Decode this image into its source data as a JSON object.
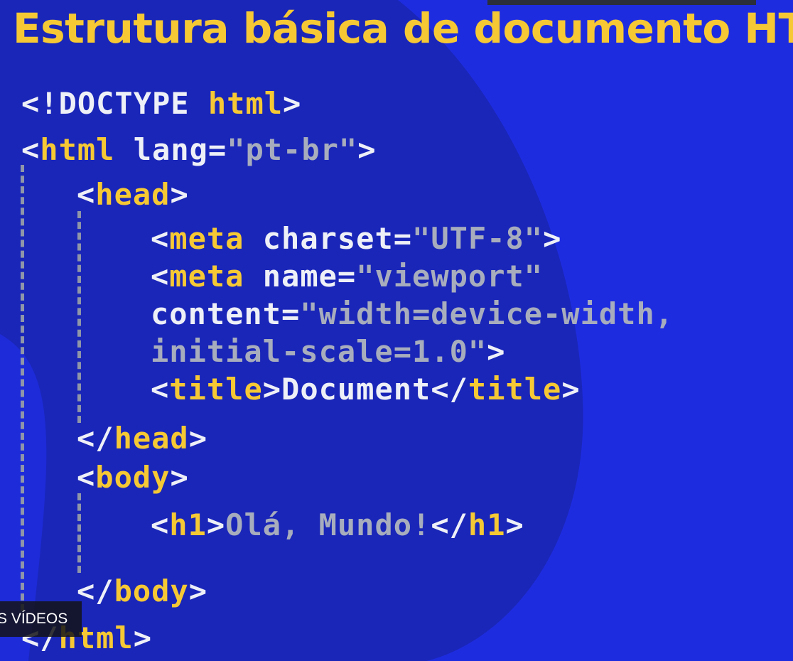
{
  "slide": {
    "title": "Estrutura básica de documento HT",
    "caption": "S VÍDEOS"
  },
  "colors": {
    "background": "#1e2ce0",
    "background_blob": "#1a26b8",
    "title": "#f6c934",
    "punctuation": "#eef0f7",
    "tag": "#f6c934",
    "attribute": "#eef0f7",
    "value": "#a8adbd",
    "text": "#eef0f7",
    "guide": "#8f96a8"
  },
  "code": {
    "lines": [
      [
        [
          "punct",
          "<!DOCTYPE "
        ],
        [
          "tag",
          "html"
        ],
        [
          "punct",
          ">"
        ]
      ],
      [
        [
          "punct",
          "<"
        ],
        [
          "tag",
          "html"
        ],
        [
          "punct",
          " "
        ],
        [
          "attr",
          "lang="
        ],
        [
          "value",
          "\"pt-br\""
        ],
        [
          "punct",
          ">"
        ]
      ],
      [
        [
          "punct",
          "<"
        ],
        [
          "tag",
          "head"
        ],
        [
          "punct",
          ">"
        ]
      ],
      [
        [
          "punct",
          "<"
        ],
        [
          "tag",
          "meta"
        ],
        [
          "punct",
          " "
        ],
        [
          "attr",
          "charset="
        ],
        [
          "value",
          "\"UTF-8\""
        ],
        [
          "punct",
          ">"
        ]
      ],
      [
        [
          "punct",
          "<"
        ],
        [
          "tag",
          "meta"
        ],
        [
          "punct",
          " "
        ],
        [
          "attr",
          "name="
        ],
        [
          "value",
          "\"viewport\""
        ]
      ],
      [
        [
          "attr",
          "content="
        ],
        [
          "value",
          "\"width=device-width,"
        ]
      ],
      [
        [
          "value",
          "initial-scale=1.0\""
        ],
        [
          "punct",
          ">"
        ]
      ],
      [
        [
          "punct",
          "<"
        ],
        [
          "tag",
          "title"
        ],
        [
          "punct",
          ">"
        ],
        [
          "text",
          "Document"
        ],
        [
          "punct",
          "</"
        ],
        [
          "tag",
          "title"
        ],
        [
          "punct",
          ">"
        ]
      ],
      [
        [
          "punct",
          "</"
        ],
        [
          "tag",
          "head"
        ],
        [
          "punct",
          ">"
        ]
      ],
      [
        [
          "punct",
          "<"
        ],
        [
          "tag",
          "body"
        ],
        [
          "punct",
          ">"
        ]
      ],
      [
        [
          "punct",
          "<"
        ],
        [
          "tag",
          "h1"
        ],
        [
          "punct",
          ">"
        ],
        [
          "value",
          "Olá, Mundo!"
        ],
        [
          "punct",
          "</"
        ],
        [
          "tag",
          "h1"
        ],
        [
          "punct",
          ">"
        ]
      ],
      [
        [
          "punct",
          "</"
        ],
        [
          "tag",
          "body"
        ],
        [
          "punct",
          ">"
        ]
      ],
      [
        [
          "punct",
          "</"
        ],
        [
          "tag",
          "html"
        ],
        [
          "punct",
          ">"
        ]
      ]
    ]
  }
}
